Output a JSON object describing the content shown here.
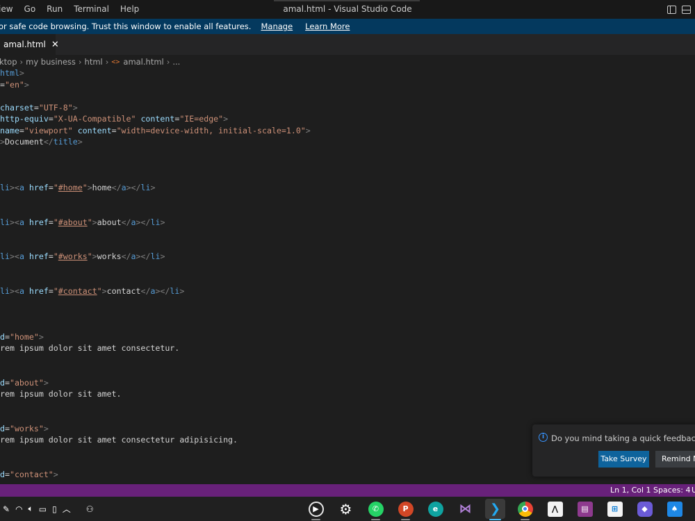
{
  "titlebar": {
    "menus": [
      "iew",
      "Go",
      "Run",
      "Terminal",
      "Help"
    ],
    "title": "amal.html - Visual Studio Code"
  },
  "banner": {
    "message": "or safe code browsing. Trust this window to enable all features.",
    "manage": "Manage",
    "learn_more": "Learn More"
  },
  "tabs": [
    {
      "label": "amal.html",
      "close": "✕"
    }
  ],
  "breadcrumb": {
    "items": [
      "ktop",
      "my business",
      "html",
      "amal.html",
      "..."
    ]
  },
  "code": {
    "l1": "html",
    "l2_attr_eq": "=",
    "l2_val": "\"en\"",
    "charset_attr": "charset",
    "charset_val": "\"UTF-8\"",
    "http_attr": "http-equiv",
    "http_val": "\"X-UA-Compatible\"",
    "content_attr": "content",
    "http_content_val": "\"IE=edge\"",
    "name_attr": "name",
    "name_val": "\"viewport\"",
    "viewport_val": "\"width=device-width, initial-scale=1.0\"",
    "title_text": "Document",
    "title_tag": "title",
    "li": "li",
    "a": "a",
    "href": "href",
    "links": [
      {
        "href": "#home",
        "text": "home"
      },
      {
        "href": "#about",
        "text": "about"
      },
      {
        "href": "#works",
        "text": "works"
      },
      {
        "href": "#contact",
        "text": "contact"
      }
    ],
    "sections": [
      {
        "id": "\"home\"",
        "text": "rem ipsum dolor sit amet consectetur."
      },
      {
        "id": "\"about\"",
        "text": "rem ipsum dolor sit amet."
      },
      {
        "id": "\"works\"",
        "text": "rem ipsum dolor sit amet consectetur adipisicing."
      },
      {
        "id": "\"contact\"",
        "text": ""
      }
    ],
    "d_attr": "d"
  },
  "notification": {
    "text": "Do you mind taking a quick feedback surv",
    "take_survey": "Take Survey",
    "remind": "Remind M"
  },
  "statusbar": {
    "position": "Ln 1, Col 1",
    "spaces": "Spaces: 4",
    "encoding_partial": "U"
  },
  "taskbar": {
    "apps": [
      "media-player",
      "settings",
      "whatsapp",
      "powerpoint",
      "edge",
      "visual-studio",
      "vscode",
      "chrome",
      "inkscape",
      "winrar",
      "store",
      "copilot",
      "solitaire"
    ]
  },
  "colors": {
    "statusbar": "#68217a",
    "banner": "#04395e",
    "accent_button": "#0e639c"
  }
}
